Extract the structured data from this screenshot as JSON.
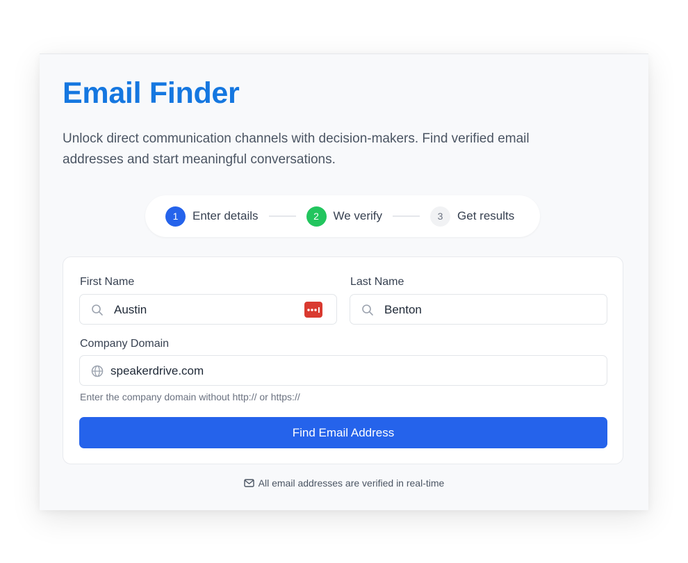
{
  "header": {
    "title": "Email Finder",
    "subtitle": "Unlock direct communication channels with decision-makers. Find verified email addresses and start meaningful conversations."
  },
  "steps": [
    {
      "number": "1",
      "label": "Enter details",
      "color": "#2563eb"
    },
    {
      "number": "2",
      "label": "We verify",
      "color": "#22c55e"
    },
    {
      "number": "3",
      "label": "Get results",
      "color": "#f1f2f4"
    }
  ],
  "form": {
    "first_name": {
      "label": "First Name",
      "value": "Austin",
      "icon": "search-icon"
    },
    "last_name": {
      "label": "Last Name",
      "value": "Benton",
      "icon": "search-icon"
    },
    "company_domain": {
      "label": "Company Domain",
      "value": "speakerdrive.com",
      "icon": "globe-icon",
      "hint": "Enter the company domain without http:// or https://"
    },
    "submit_label": "Find Email Address"
  },
  "footer": {
    "note": "All email addresses are verified in real-time",
    "icon": "mail-icon"
  },
  "colors": {
    "title": "#1577e0",
    "primary": "#2563eb",
    "success": "#22c55e",
    "password_manager": "#d93a30"
  }
}
